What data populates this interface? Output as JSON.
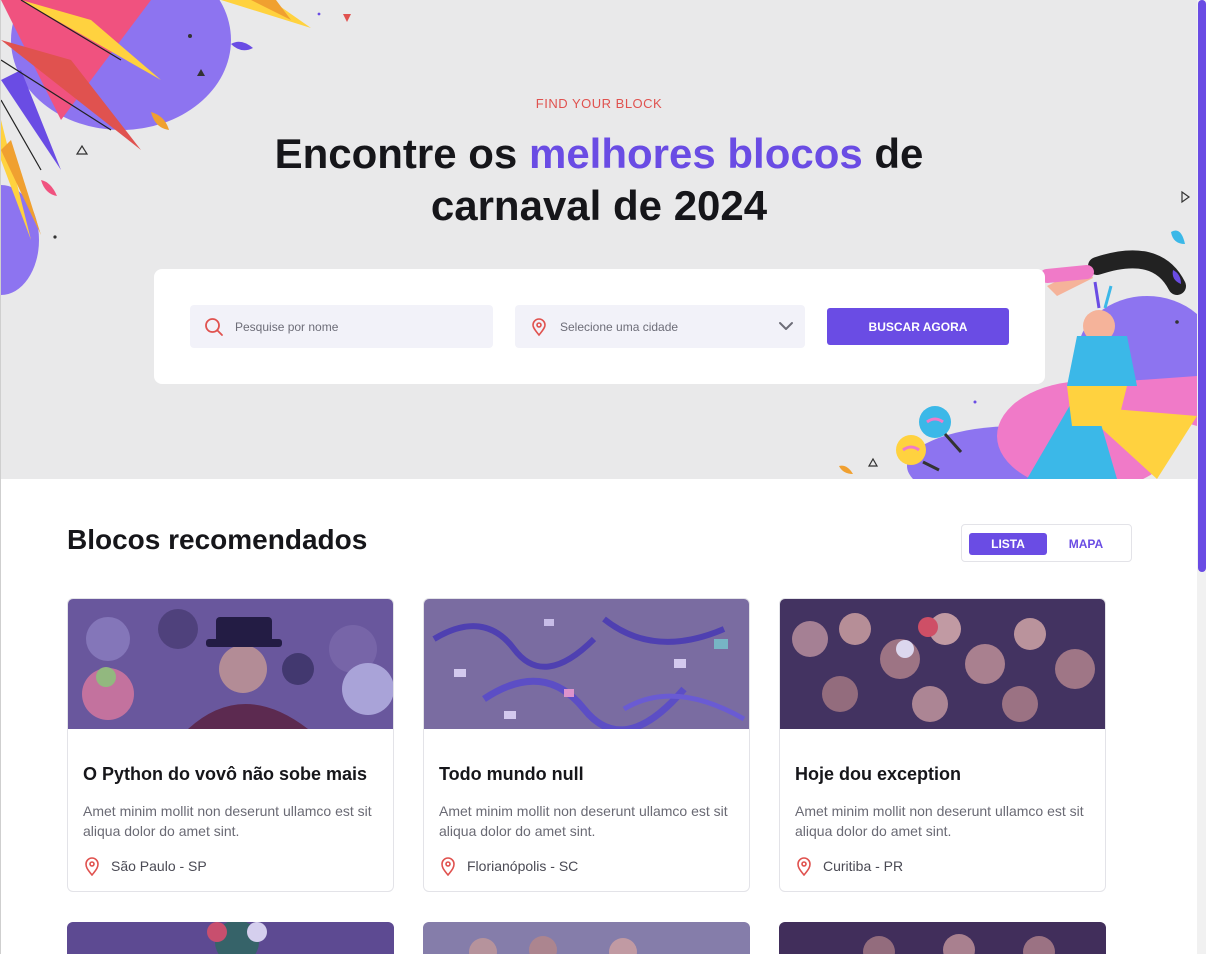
{
  "hero": {
    "eyebrow": "FIND YOUR BLOCK",
    "headline_part1": "Encontre os ",
    "headline_accent": "melhores blocos",
    "headline_part2": " de",
    "headline_line2": "carnaval de 2024"
  },
  "search": {
    "name_placeholder": "Pesquise por nome",
    "city_placeholder": "Selecione uma cidade",
    "button_label": "BUSCAR AGORA"
  },
  "section": {
    "title": "Blocos recomendados",
    "view_list": "LISTA",
    "view_map": "MAPA",
    "active_view": "LISTA"
  },
  "cards": [
    {
      "title": "O Python do vovô não sobe mais",
      "description": "Amet minim mollit non deserunt ullamco est sit aliqua dolor do amet sint.",
      "location": "São Paulo - SP"
    },
    {
      "title": "Todo mundo null",
      "description": "Amet minim mollit non deserunt ullamco est sit aliqua dolor do amet sint.",
      "location": "Florianópolis - SC"
    },
    {
      "title": "Hoje dou exception",
      "description": "Amet minim mollit non deserunt ullamco est sit aliqua dolor do amet sint.",
      "location": "Curitiba - PR"
    }
  ],
  "colors": {
    "accent": "#6a4ce4",
    "eyebrow": "#e0524f",
    "hero_bg": "#e9e9ea",
    "pin": "#e0524f"
  },
  "icons": {
    "search": "search-icon",
    "location": "map-pin-icon",
    "dropdown": "chevron-down-icon"
  }
}
